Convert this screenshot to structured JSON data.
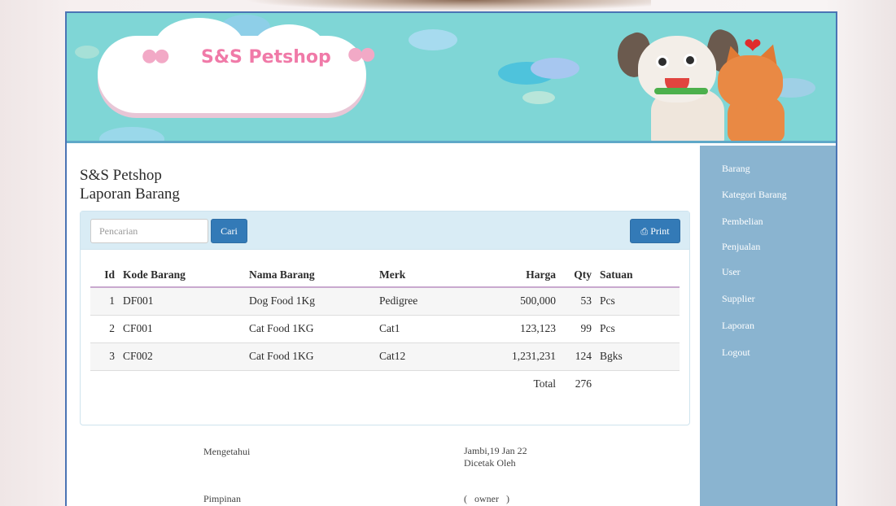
{
  "banner": {
    "brand": "S&S Petshop"
  },
  "report": {
    "company": "S&S Petshop",
    "title": "Laporan Barang"
  },
  "search": {
    "placeholder": "Pencarian",
    "button": "Cari"
  },
  "print_button": "Print",
  "table": {
    "headers": [
      "Id",
      "Kode Barang",
      "Nama Barang",
      "Merk",
      "Harga",
      "Qty",
      "Satuan"
    ],
    "rows": [
      [
        "1",
        "DF001",
        "Dog Food 1Kg",
        "Pedigree",
        "500,000",
        "53",
        "Pcs"
      ],
      [
        "2",
        "CF001",
        "Cat Food 1KG",
        "Cat1",
        "123,123",
        "99",
        "Pcs"
      ],
      [
        "3",
        "CF002",
        "Cat Food 1KG",
        "Cat12",
        "1,231,231",
        "124",
        "Bgks"
      ]
    ],
    "total_label": "Total",
    "total_qty": "276"
  },
  "signature": {
    "mengetahui": "Mengetahui",
    "place_date": "Jambi,19 Jan 22",
    "printed_by": "Dicetak Oleh",
    "pimpinan": "Pimpinan",
    "owner": "(   owner   )"
  },
  "sidebar": {
    "items": [
      {
        "label": "Barang"
      },
      {
        "label": "Kategori Barang"
      },
      {
        "label": "Pembelian"
      },
      {
        "label": "Penjualan"
      },
      {
        "label": "User"
      },
      {
        "label": "Supplier"
      },
      {
        "label": "Laporan"
      },
      {
        "label": "Logout"
      }
    ]
  },
  "colors": {
    "banner_bg": "#7fd6d6",
    "panel_head": "#d9ecf5",
    "button_primary": "#337ab7",
    "sidebar_bg": "#8ab4d0",
    "brand_pink": "#f07aa8"
  }
}
